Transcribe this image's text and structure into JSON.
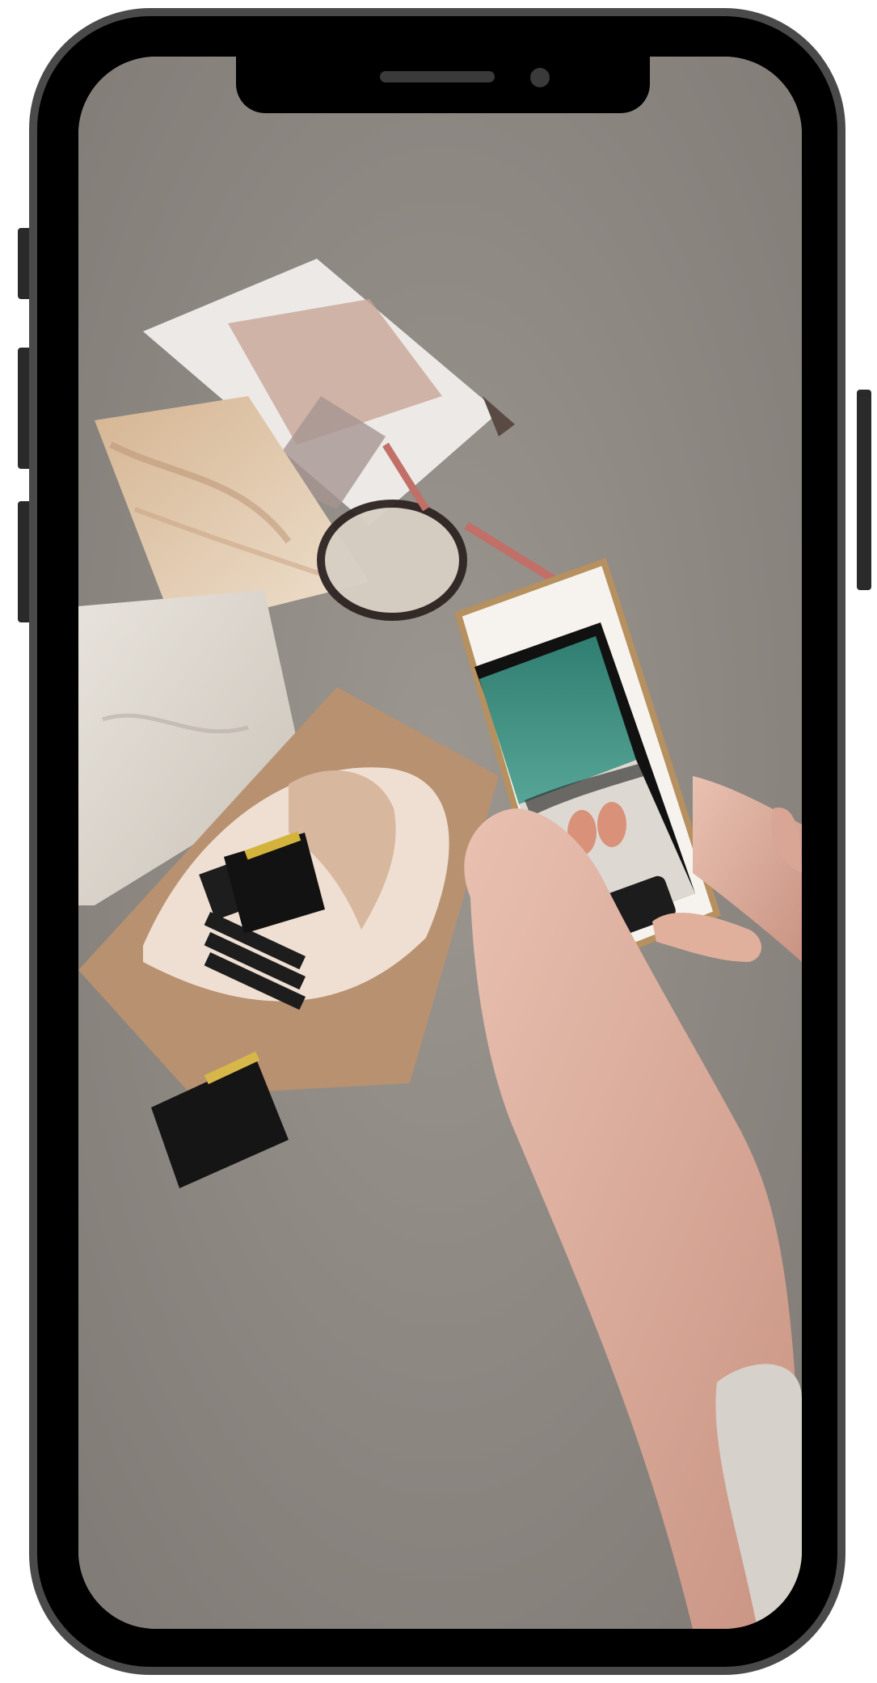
{
  "photo": {
    "subject": "",
    "background_color": "#8f8a85",
    "frame_color": "#000000",
    "bezel_color": "#4a4a4a"
  }
}
